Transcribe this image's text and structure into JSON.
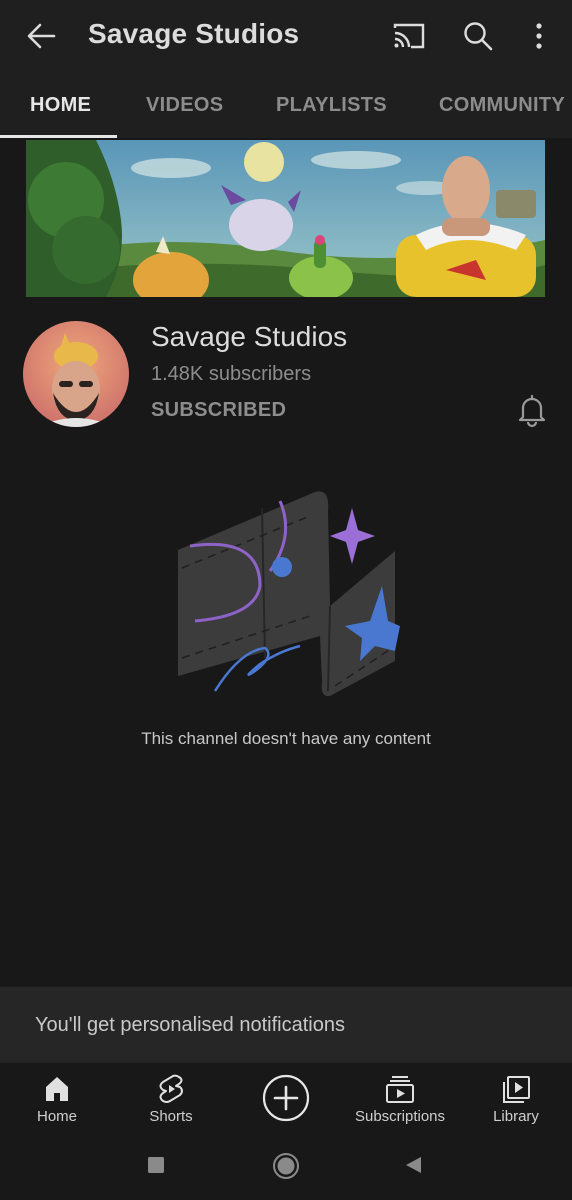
{
  "header": {
    "title": "Savage Studios",
    "back_icon": "arrow-left-icon",
    "actions": [
      "cast-icon",
      "search-icon",
      "more-vert-icon"
    ]
  },
  "tabs": [
    {
      "label": "HOME",
      "active": true
    },
    {
      "label": "VIDEOS",
      "active": false
    },
    {
      "label": "PLAYLISTS",
      "active": false
    },
    {
      "label": "COMMUNITY",
      "active": false
    }
  ],
  "channel": {
    "name": "Savage Studios",
    "subscribers": "1.48K subscribers",
    "subscribe_state": "SUBSCRIBED",
    "bell_icon": "bell-icon"
  },
  "empty_state": {
    "message": "This channel doesn't have any content"
  },
  "snackbar": {
    "text": "You'll get personalised notifications"
  },
  "bottom_nav": [
    {
      "label": "Home",
      "icon": "home-icon"
    },
    {
      "label": "Shorts",
      "icon": "shorts-icon"
    },
    {
      "label": "",
      "icon": "create-plus-icon"
    },
    {
      "label": "Subscriptions",
      "icon": "subscriptions-icon"
    },
    {
      "label": "Library",
      "icon": "library-icon"
    }
  ],
  "colors": {
    "background": "#181818",
    "header": "#1f1f1f",
    "accent_purple": "#9c6fd8",
    "accent_blue": "#4a78d0"
  }
}
